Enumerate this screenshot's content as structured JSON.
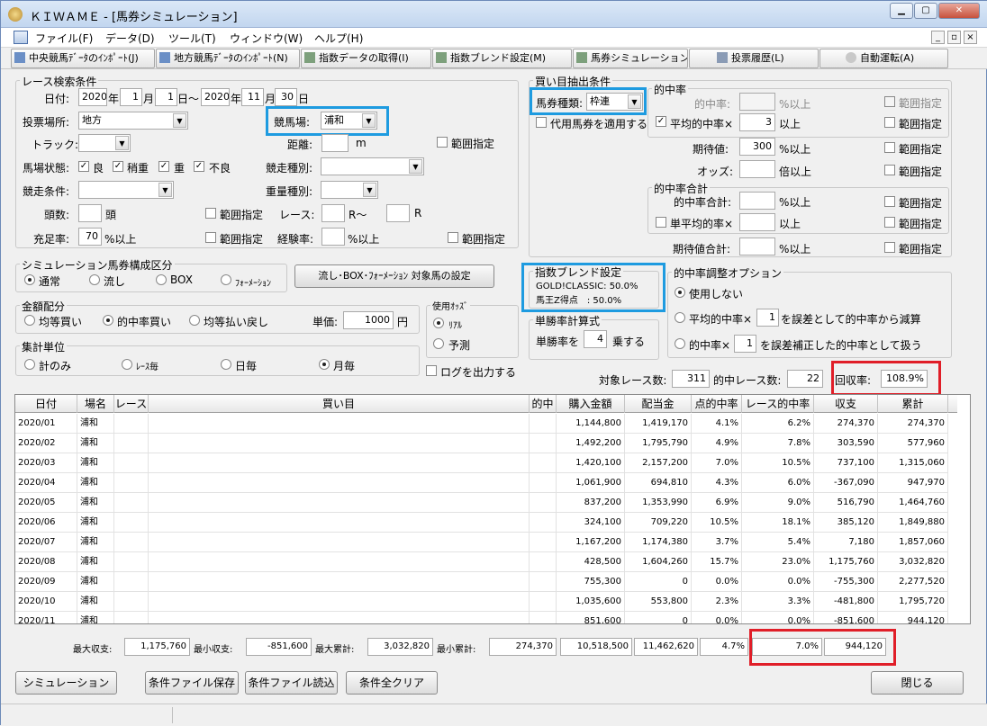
{
  "window": {
    "title": "ＫＩＷＡＭＥ - [馬券シミュレーション]"
  },
  "menu": [
    "ファイル(F)",
    "データ(D)",
    "ツール(T)",
    "ウィンドウ(W)",
    "ヘルプ(H)"
  ],
  "toolbar": [
    "中央競馬ﾃﾞｰﾀのｲﾝﾎﾟｰﾄ(J)",
    "地方競馬ﾃﾞｰﾀのｲﾝﾎﾟｰﾄ(N)",
    "指数データの取得(I)",
    "指数ブレンド設定(M)",
    "馬券シミュレーション(B)",
    "投票履歴(L)",
    "自動運転(A)"
  ],
  "race": {
    "group": "レース検索条件",
    "date_label": "日付:",
    "from_year": "2020",
    "year_u": "年",
    "from_month": "1",
    "month_u": "月",
    "from_day": "1",
    "day_u": "日",
    "tilde": "日～",
    "to_year": "2020",
    "to_month": "11",
    "to_day": "30",
    "venue_label": "投票場所:",
    "venue": "地方",
    "track_label": "競馬場:",
    "track": "浦和",
    "course_label": "トラック:",
    "distance_label": "距離:",
    "distance_unit": "m",
    "range": "範囲指定",
    "cond_label": "馬場状態:",
    "cond": [
      "良",
      "稍重",
      "重",
      "不良"
    ],
    "kind_label": "競走種別:",
    "condition_label": "競走条件:",
    "weight_label": "重量種別:",
    "heads_label": "頭数:",
    "heads_unit": "頭",
    "race_label": "レース:",
    "race_from": "R～",
    "race_to": "R",
    "fill_label": "充足率:",
    "fill": "70",
    "fill_unit": "%以上",
    "exp_label": "経験率:",
    "exp_unit": "%以上"
  },
  "sim": {
    "group": "シミュレーション馬券構成区分",
    "options": [
      "通常",
      "流し",
      "BOX",
      "ﾌｫｰﾒｰｼｮﾝ"
    ],
    "button": "流し･BOX･ﾌｫｰﾒｰｼｮﾝ 対象馬の設定"
  },
  "money": {
    "group": "金額配分",
    "options": [
      "均等買い",
      "的中率買い",
      "均等払い戻し"
    ],
    "unit_label": "単価:",
    "unit": "1000",
    "yen": "円"
  },
  "odds": {
    "group": "使用ｵｯｽﾞ",
    "options": [
      "ﾘｱﾙ",
      "予測"
    ]
  },
  "agg": {
    "group": "集計単位",
    "options": [
      "計のみ",
      "ﾚｰｽ毎",
      "日毎",
      "月毎"
    ]
  },
  "log": "ログを出力する",
  "buy": {
    "group": "買い目抽出条件",
    "type_label": "馬券種類:",
    "type": "枠連",
    "proxy": "代用馬券を適用する",
    "hit_group": "的中率",
    "hit_label": "的中率:",
    "hit_unit": "%以上",
    "avg_label": "平均的中率×",
    "avg_value": "3",
    "avg_unit": "以上",
    "exp_label": "期待値:",
    "exp_value": "300",
    "exp_unit": "%以上",
    "odds_label": "オッズ:",
    "odds_unit": "倍以上",
    "range": "範囲指定",
    "sum_group": "的中率合計",
    "sum_label": "的中率合計:",
    "sum_unit": "%以上",
    "single_label": "単平均的率×",
    "single_unit": "以上",
    "expsum_label": "期待値合計:",
    "expsum_unit": "%以上"
  },
  "blend": {
    "group": "指数ブレンド設定",
    "line1": "GOLD!CLASSIC: 50.0%",
    "line2": "馬王Z得点　: 50.0%"
  },
  "win": {
    "group": "単勝率計算式",
    "label": "単勝率を",
    "value": "4",
    "unit": "乗する"
  },
  "adjust": {
    "group": "的中率調整オプション",
    "opt1": "使用しない",
    "opt2a": "平均的中率×",
    "opt2v": "1",
    "opt2b": "を誤差として的中率から減算",
    "opt3a": "的中率×",
    "opt3v": "1",
    "opt3b": "を誤差補正した的中率として扱う"
  },
  "summary": {
    "races_label": "対象レース数:",
    "races": "311",
    "hits_label": "的中レース数:",
    "hits": "22",
    "return_label": "回収率:",
    "return": "108.9%"
  },
  "table": {
    "headers": [
      "日付",
      "場名",
      "レース",
      "買い目",
      "的中",
      "購入金額",
      "配当金",
      "点的中率",
      "レース的中率",
      "収支",
      "累計"
    ],
    "rows": [
      [
        "2020/01",
        "浦和",
        "",
        "",
        "",
        "1,144,800",
        "1,419,170",
        "4.1%",
        "6.2%",
        "274,370",
        "274,370"
      ],
      [
        "2020/02",
        "浦和",
        "",
        "",
        "",
        "1,492,200",
        "1,795,790",
        "4.9%",
        "7.8%",
        "303,590",
        "577,960"
      ],
      [
        "2020/03",
        "浦和",
        "",
        "",
        "",
        "1,420,100",
        "2,157,200",
        "7.0%",
        "10.5%",
        "737,100",
        "1,315,060"
      ],
      [
        "2020/04",
        "浦和",
        "",
        "",
        "",
        "1,061,900",
        "694,810",
        "4.3%",
        "6.0%",
        "-367,090",
        "947,970"
      ],
      [
        "2020/05",
        "浦和",
        "",
        "",
        "",
        "837,200",
        "1,353,990",
        "6.9%",
        "9.0%",
        "516,790",
        "1,464,760"
      ],
      [
        "2020/06",
        "浦和",
        "",
        "",
        "",
        "324,100",
        "709,220",
        "10.5%",
        "18.1%",
        "385,120",
        "1,849,880"
      ],
      [
        "2020/07",
        "浦和",
        "",
        "",
        "",
        "1,167,200",
        "1,174,380",
        "3.7%",
        "5.4%",
        "7,180",
        "1,857,060"
      ],
      [
        "2020/08",
        "浦和",
        "",
        "",
        "",
        "428,500",
        "1,604,260",
        "15.7%",
        "23.0%",
        "1,175,760",
        "3,032,820"
      ],
      [
        "2020/09",
        "浦和",
        "",
        "",
        "",
        "755,300",
        "0",
        "0.0%",
        "0.0%",
        "-755,300",
        "2,277,520"
      ],
      [
        "2020/10",
        "浦和",
        "",
        "",
        "",
        "1,035,600",
        "553,800",
        "2.3%",
        "3.3%",
        "-481,800",
        "1,795,720"
      ],
      [
        "2020/11",
        "浦和",
        "",
        "",
        "",
        "851,600",
        "0",
        "0.0%",
        "0.0%",
        "-851,600",
        "944,120"
      ]
    ]
  },
  "totals": {
    "max_income_label": "最大収支:",
    "max_income": "1,175,760",
    "min_income_label": "最小収支:",
    "min_income": "-851,600",
    "max_cum_label": "最大累計:",
    "max_cum": "3,032,820",
    "min_cum_label": "最小累計:",
    "min_cum": "274,370",
    "purchase": "10,518,500",
    "payout": "11,462,620",
    "point_rate": "4.7%",
    "race_rate": "7.0%",
    "balance": "944,120"
  },
  "buttons": {
    "simulate": "シミュレーション",
    "save": "条件ファイル保存",
    "load": "条件ファイル読込",
    "clear": "条件全クリア",
    "close": "閉じる"
  }
}
